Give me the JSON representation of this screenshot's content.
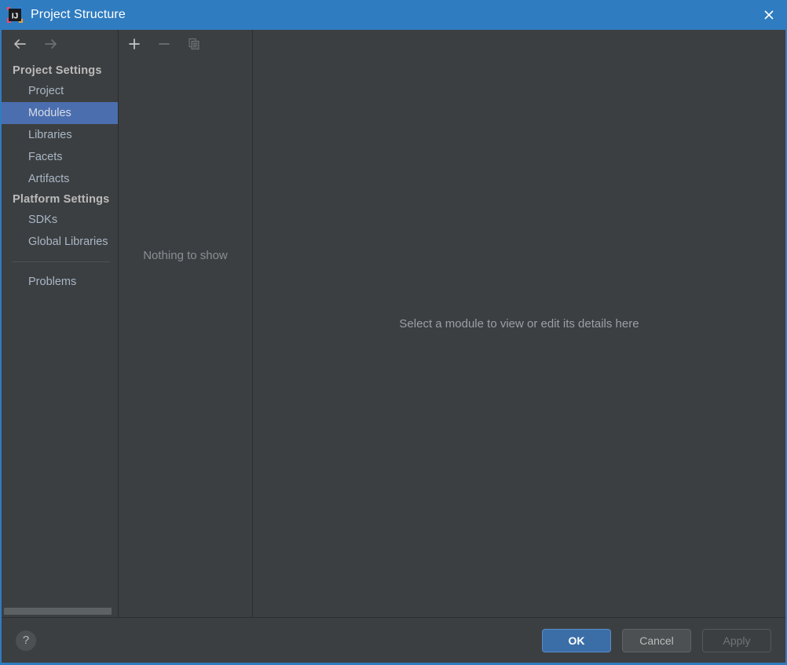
{
  "window": {
    "title": "Project Structure",
    "app_icon": "intellij-idea-icon",
    "close_icon": "close-icon",
    "accent_color": "#2f7cc0",
    "background_color": "#3c3f41",
    "selection_color": "#4b6eaf"
  },
  "sidebar": {
    "back_icon": "back-arrow-icon",
    "forward_icon": "forward-arrow-icon",
    "groups": [
      {
        "title": "Project Settings",
        "items": [
          {
            "label": "Project",
            "selected": false
          },
          {
            "label": "Modules",
            "selected": true
          },
          {
            "label": "Libraries",
            "selected": false
          },
          {
            "label": "Facets",
            "selected": false
          },
          {
            "label": "Artifacts",
            "selected": false
          }
        ]
      },
      {
        "title": "Platform Settings",
        "items": [
          {
            "label": "SDKs",
            "selected": false
          },
          {
            "label": "Global Libraries",
            "selected": false
          }
        ]
      }
    ],
    "extra_items": [
      {
        "label": "Problems",
        "selected": false
      }
    ]
  },
  "middle_panel": {
    "toolbar": [
      {
        "name": "add-button",
        "icon": "plus-icon",
        "enabled": true
      },
      {
        "name": "remove-button",
        "icon": "minus-icon",
        "enabled": false
      },
      {
        "name": "copy-button",
        "icon": "copy-icon",
        "enabled": false
      }
    ],
    "empty_text": "Nothing to show"
  },
  "detail_panel": {
    "empty_text": "Select a module to view or edit its details here"
  },
  "footer": {
    "help_label": "?",
    "help_icon": "help-icon",
    "buttons": [
      {
        "label": "OK",
        "style": "primary",
        "enabled": true
      },
      {
        "label": "Cancel",
        "style": "normal",
        "enabled": true
      },
      {
        "label": "Apply",
        "style": "disabled",
        "enabled": false
      }
    ]
  }
}
